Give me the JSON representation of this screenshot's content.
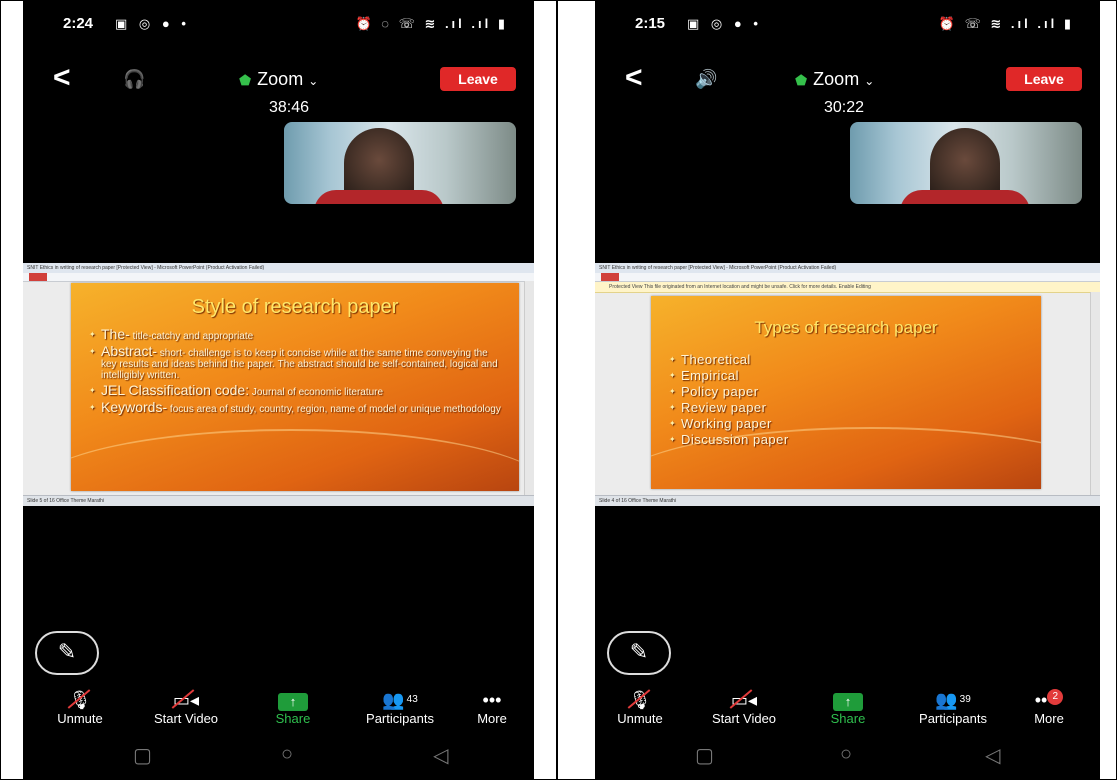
{
  "panels": [
    {
      "status": {
        "time": "2:24",
        "left_icons": "▣ ◎ ●  •",
        "right_icons": "⏰ ◌ ☏ ≋ .ıl .ıl ▮"
      },
      "topbar": {
        "audio_icon": "headset-icon",
        "title": "Zoom",
        "leave_label": "Leave"
      },
      "timer": "38:46",
      "ppt": {
        "window_title": "SNIT Ethics in writing of research paper [Protected View] - Microsoft PowerPoint (Product Activation Failed)",
        "status_text": "Slide 5 of 16   Office Theme   Marathi"
      },
      "slide": {
        "title": "Style of research paper",
        "bullets": [
          {
            "head": "The-",
            "text": " title-catchy and appropriate"
          },
          {
            "head": "Abstract-",
            "text": " short- challenge is to keep it concise while at the same time conveying the key results and ideas behind the paper. The abstract should be self-contained, logical and intelligibly written."
          },
          {
            "head": "JEL Classification code:",
            "text": " Journal of economic literature"
          },
          {
            "head": "Keywords-",
            "text": " focus area of study, country, region, name of model or unique methodology"
          }
        ]
      },
      "toolbar": {
        "unmute": "Unmute",
        "start_video": "Start Video",
        "share": "Share",
        "participants": "Participants",
        "participants_count": "43",
        "more": "More"
      }
    },
    {
      "status": {
        "time": "2:15",
        "left_icons": "▣ ◎ ●  •",
        "right_icons": "⏰ ☏ ≋ .ıl .ıl ▮"
      },
      "topbar": {
        "audio_icon": "speaker-icon",
        "title": "Zoom",
        "leave_label": "Leave"
      },
      "timer": "30:22",
      "ppt": {
        "window_title": "SNIT Ethics in writing of research paper [Protected View] - Microsoft PowerPoint (Product Activation Failed)",
        "warning_text": "Protected View   This file originated from an Internet location and might be unsafe. Click for more details.   Enable Editing",
        "status_text": "Slide 4 of 16   Office Theme   Marathi"
      },
      "slide": {
        "title": "Types of research paper",
        "bullets": [
          "Theoretical",
          "Empirical",
          "Policy paper",
          "Review paper",
          "Working paper",
          "Discussion paper"
        ]
      },
      "toolbar": {
        "unmute": "Unmute",
        "start_video": "Start Video",
        "share": "Share",
        "participants": "Participants",
        "participants_count": "39",
        "more": "More",
        "more_badge": "2"
      }
    }
  ],
  "colors": {
    "leave": "#e02828",
    "share": "#1f9c3a",
    "shield": "#35c04b",
    "slide_orange": "#f18a1a"
  }
}
